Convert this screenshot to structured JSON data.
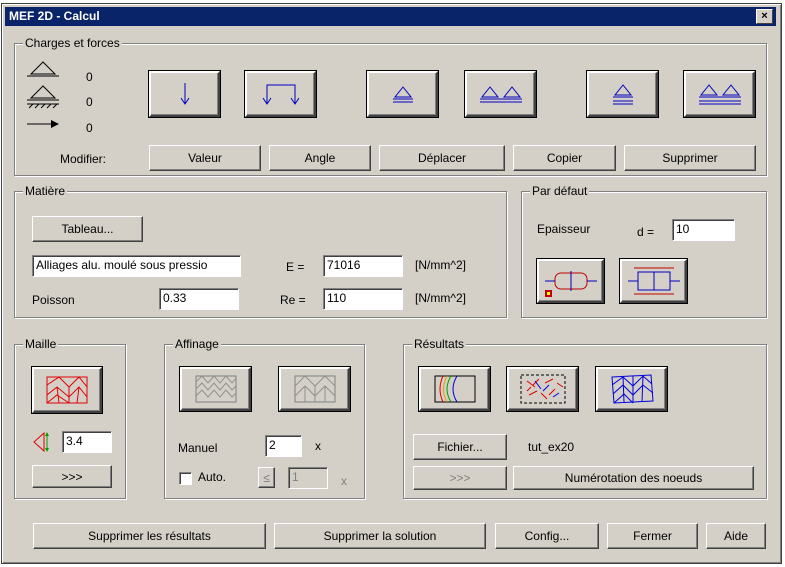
{
  "window": {
    "title": "MEF 2D - Calcul",
    "close_label": "×"
  },
  "charges": {
    "label": "Charges et forces",
    "counts": [
      "0",
      "0",
      "0"
    ],
    "modifier_label": "Modifier:",
    "buttons": {
      "valeur": "Valeur",
      "angle": "Angle",
      "deplacer": "Déplacer",
      "copier": "Copier",
      "supprimer": "Supprimer"
    }
  },
  "matiere": {
    "label": "Matière",
    "tableau": "Tableau...",
    "material": "Alliages alu. moulé sous pressio",
    "poisson_label": "Poisson",
    "poisson": "0.33",
    "e_label": "E =",
    "e_value": "71016",
    "e_unit": "[N/mm^2]",
    "re_label": "Re =",
    "re_value": "110",
    "re_unit": "[N/mm^2]"
  },
  "defaut": {
    "label": "Par défaut",
    "epaisseur": "Epaisseur",
    "d_label": "d =",
    "d_value": "10"
  },
  "maille": {
    "label": "Maille",
    "size": "3.4",
    "more": ">>>"
  },
  "affinage": {
    "label": "Affinage",
    "manuel": "Manuel",
    "manuel_value": "2",
    "x1": "x",
    "auto": "Auto.",
    "auto_value": "1",
    "x2": "x",
    "le": "≤"
  },
  "resultats": {
    "label": "Résultats",
    "fichier": "Fichier...",
    "file_name": "tut_ex20",
    "more": ">>>",
    "numerotation": "Numérotation des noeuds"
  },
  "footer": {
    "suppr_resultats": "Supprimer les résultats",
    "suppr_solution": "Supprimer la solution",
    "config": "Config...",
    "fermer": "Fermer",
    "aide": "Aide"
  }
}
